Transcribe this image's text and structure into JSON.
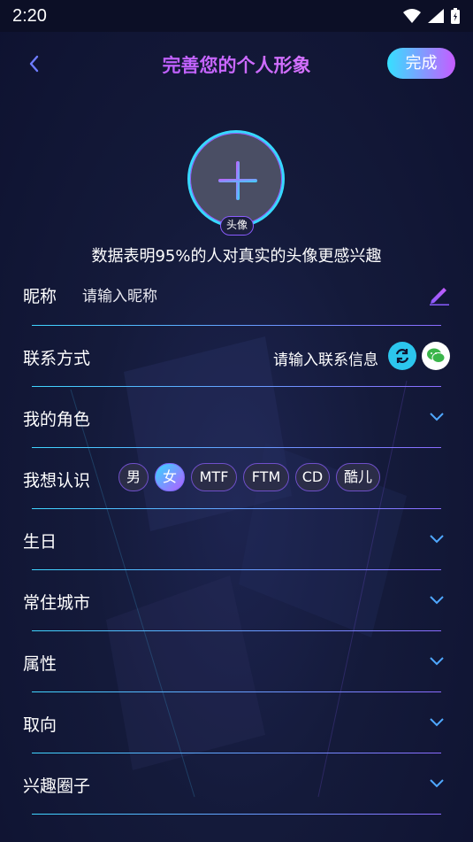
{
  "status_bar": {
    "time": "2:20"
  },
  "header": {
    "title": "完善您的个人形象",
    "done_label": "完成"
  },
  "avatar": {
    "label": "头像"
  },
  "hint": "数据表明95%的人对真实的头像更感兴趣",
  "nickname": {
    "label": "昵称",
    "placeholder": "请输入昵称"
  },
  "contact": {
    "label": "联系方式",
    "hint": "请输入联系信息"
  },
  "role": {
    "label": "我的角色"
  },
  "want_meet": {
    "label": "我想认识",
    "tags": [
      "男",
      "女",
      "MTF",
      "FTM",
      "CD",
      "酷儿"
    ],
    "selected": "女"
  },
  "birthday": {
    "label": "生日"
  },
  "city": {
    "label": "常住城市"
  },
  "attribute": {
    "label": "属性"
  },
  "orientation": {
    "label": "取向"
  },
  "interest": {
    "label": "兴趣圈子"
  },
  "colors": {
    "accent_cyan": "#36d8ff",
    "accent_purple": "#b45cff",
    "title": "#c77dff"
  }
}
